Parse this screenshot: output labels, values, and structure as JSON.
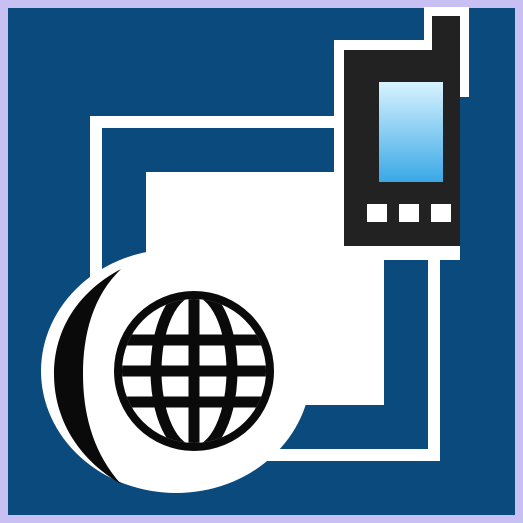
{
  "icon": {
    "kind": "app-icon",
    "motifs": [
      "frame-outline",
      "mobile-phone-icon",
      "globe-icon"
    ],
    "colors": {
      "border": "#c8c0f2",
      "background": "#0b4a7d",
      "frame_white": "#ffffff",
      "frame_blue": "#0b4a7d",
      "phone_body": "#222222",
      "phone_screen_top": "#d8f3ff",
      "phone_screen_bottom": "#3aa8e6",
      "phone_buttons": "#ffffff",
      "globe_stroke": "#0a0a0a",
      "globe_fill": "#ffffff"
    }
  }
}
